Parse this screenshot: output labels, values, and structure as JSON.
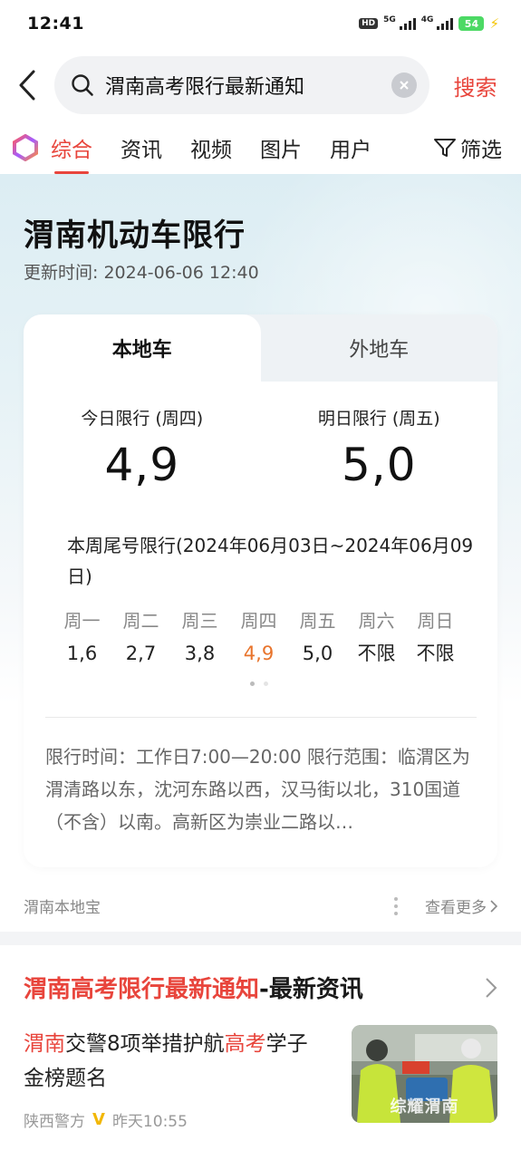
{
  "status_bar": {
    "time": "12:41",
    "hd": "HD",
    "net1": "5G",
    "net2": "4G",
    "battery": "54"
  },
  "search": {
    "query": "渭南高考限行最新通知",
    "button": "搜索"
  },
  "tabs": {
    "items": [
      "综合",
      "资讯",
      "视频",
      "图片",
      "用户"
    ],
    "active": "综合",
    "filter": "筛选"
  },
  "hero": {
    "title": "渭南机动车限行",
    "updated": "更新时间: 2024-06-06 12:40",
    "card_tabs": [
      "本地车",
      "外地车"
    ],
    "today_label": "今日限行 (周四)",
    "today_value": "4,9",
    "tomorrow_label": "明日限行 (周五)",
    "tomorrow_value": "5,0",
    "week_title": "本周尾号限行(2024年06月03日~2024年06月09日)",
    "week": [
      {
        "day": "周一",
        "nums": "1,6"
      },
      {
        "day": "周二",
        "nums": "2,7"
      },
      {
        "day": "周三",
        "nums": "3,8"
      },
      {
        "day": "周四",
        "nums": "4,9"
      },
      {
        "day": "周五",
        "nums": "5,0"
      },
      {
        "day": "周六",
        "nums": "不限"
      },
      {
        "day": "周日",
        "nums": "不限"
      }
    ],
    "description": "限行时间：工作日7:00—20:00 限行范围：临渭区为渭清路以东，沈河东路以西，汉马街以北，310国道（不含）以南。高新区为崇业二路以…",
    "source": "渭南本地宝",
    "see_more": "查看更多"
  },
  "news": {
    "heading_highlight": "渭南高考限行最新通知",
    "heading_sep": "-",
    "heading_rest": "最新资讯",
    "item": {
      "title_hl1": "渭南",
      "title_mid": "交警8项举措护航",
      "title_hl2": "高考",
      "title_end": "学子金榜题名",
      "author": "陕西警方",
      "time": "昨天10:55",
      "thumb_caption": "综耀渭南"
    }
  },
  "colors": {
    "accent": "#e8453c",
    "today_highlight": "#e8742c"
  }
}
